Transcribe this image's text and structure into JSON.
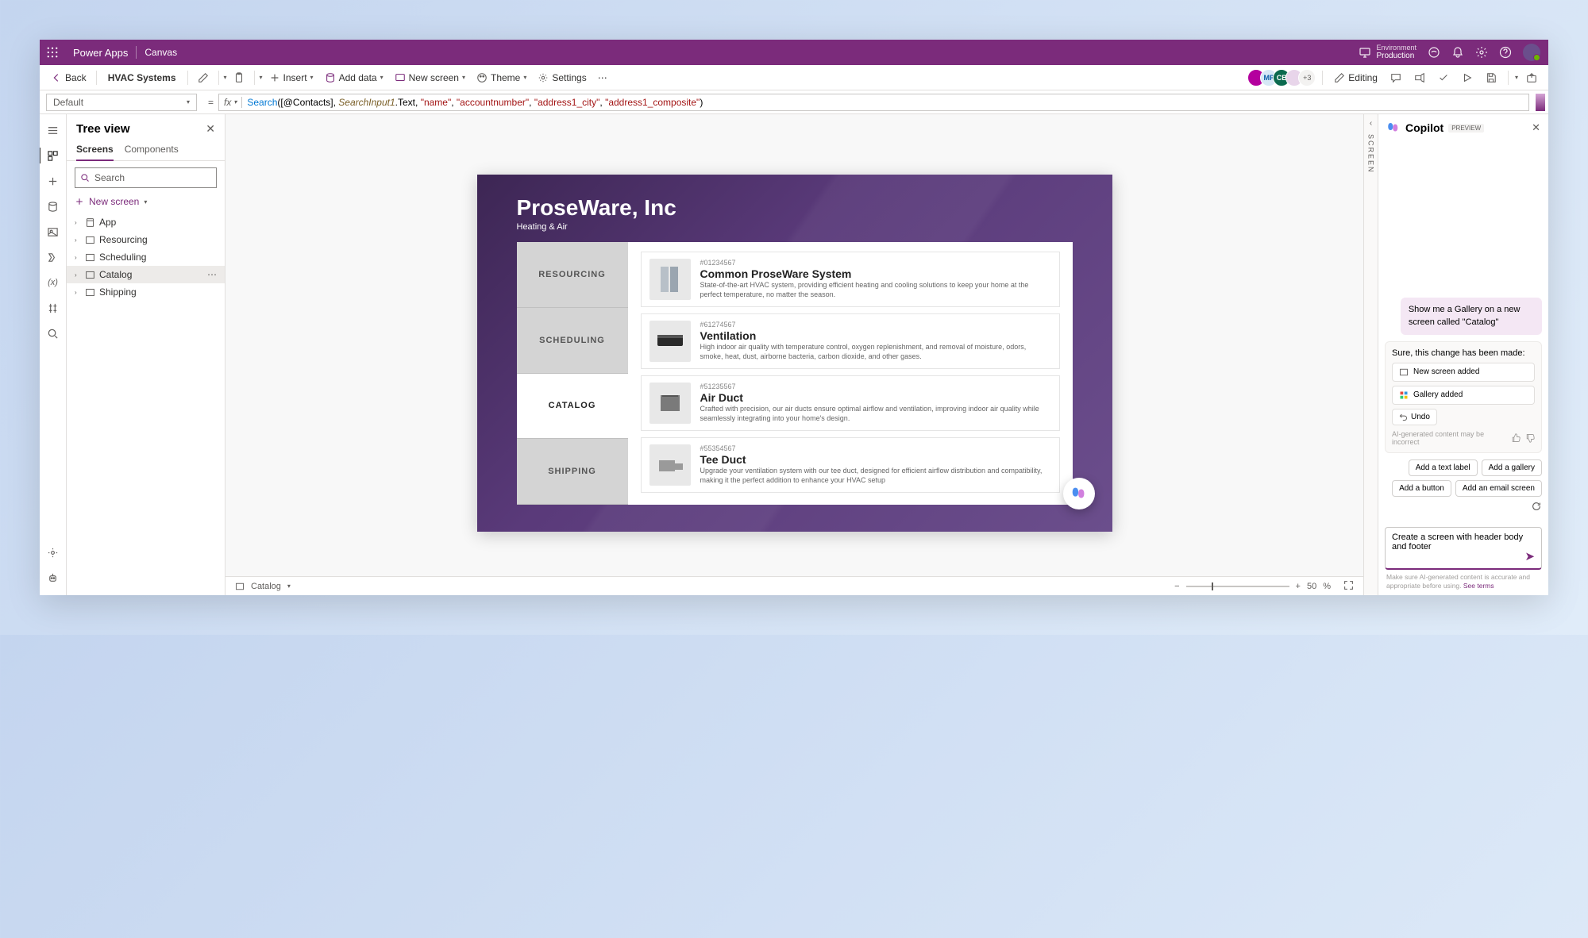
{
  "topbar": {
    "brand": "Power Apps",
    "subtitle": "Canvas",
    "env_label": "Environment",
    "env_name": "Production"
  },
  "cmdbar": {
    "back": "Back",
    "app_name": "HVAC Systems",
    "insert": "Insert",
    "add_data": "Add data",
    "new_screen": "New screen",
    "theme": "Theme",
    "settings": "Settings",
    "editing": "Editing",
    "presence_more": "+3",
    "avatars": [
      {
        "bg": "#b4009e",
        "txt": ""
      },
      {
        "bg": "#d6e8f6",
        "txt": "MP",
        "fg": "#0a5da8"
      },
      {
        "bg": "#0b6a4f",
        "txt": "CB"
      },
      {
        "bg": "#e8d5ea",
        "txt": ""
      }
    ]
  },
  "formula": {
    "property": "Default",
    "fx": "fx"
  },
  "tree": {
    "title": "Tree view",
    "tabs": {
      "screens": "Screens",
      "components": "Components"
    },
    "search_ph": "Search",
    "new_screen": "New screen",
    "items": [
      {
        "label": "App",
        "icon": "app"
      },
      {
        "label": "Resourcing",
        "icon": "screen"
      },
      {
        "label": "Scheduling",
        "icon": "screen"
      },
      {
        "label": "Catalog",
        "icon": "screen",
        "selected": true
      },
      {
        "label": "Shipping",
        "icon": "screen"
      }
    ]
  },
  "canvas": {
    "company": "ProseWare, Inc",
    "tagline": "Heating & Air",
    "nav": [
      "RESOURCING",
      "SCHEDULING",
      "CATALOG",
      "SHIPPING"
    ],
    "active_nav": 2,
    "products": [
      {
        "sku": "#01234567",
        "name": "Common ProseWare System",
        "desc": "State-of-the-art HVAC system, providing efficient heating and cooling solutions to keep your home at the perfect temperature, no matter the season."
      },
      {
        "sku": "#61274567",
        "name": "Ventilation",
        "desc": "High indoor air quality with temperature control, oxygen replenishment, and removal of moisture, odors, smoke, heat, dust, airborne bacteria, carbon dioxide, and other gases."
      },
      {
        "sku": "#51235567",
        "name": "Air Duct",
        "desc": "Crafted with precision, our air ducts ensure optimal airflow and ventilation, improving indoor air quality while seamlessly integrating into your home's design."
      },
      {
        "sku": "#55354567",
        "name": "Tee Duct",
        "desc": "Upgrade your ventilation system with our tee duct, designed for efficient airflow distribution and compatibility, making it the perfect addition to enhance your HVAC setup"
      }
    ],
    "status_screen": "Catalog",
    "zoom": "50",
    "zoom_unit": "%"
  },
  "right_collapse_label": "SCREEN",
  "copilot": {
    "title": "Copilot",
    "badge": "PREVIEW",
    "user_msg": "Show me a Gallery on a new screen called \"Catalog\"",
    "resp_text": "Sure, this change has been made:",
    "chip1": "New screen added",
    "chip2": "Gallery added",
    "undo": "Undo",
    "disclaimer": "AI-generated content may be incorrect",
    "suggestions": [
      "Add a text label",
      "Add a gallery",
      "Add a button",
      "Add an email screen"
    ],
    "draft": "Create a screen with header body and footer",
    "footer_1": "Make sure AI-generated content is accurate and appropriate before using. ",
    "footer_link": "See terms"
  }
}
